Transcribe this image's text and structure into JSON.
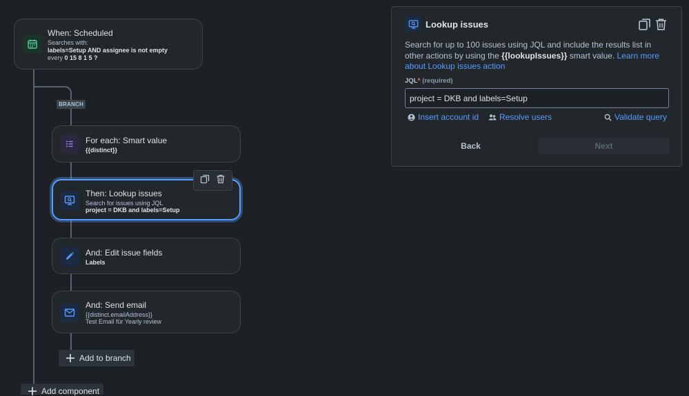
{
  "trigger": {
    "title": "When: Scheduled",
    "line1": "Searches with:",
    "line2": "labels=Setup AND assignee is not empty",
    "line3_prefix": "every ",
    "line3_value": "0 15 8 1 5 ?"
  },
  "branch_tag": "BRANCH",
  "foreach": {
    "title": "For each: Smart value",
    "sub": "{{distinct}}"
  },
  "lookup": {
    "title": "Then: Lookup issues",
    "sub1": "Search for issues using JQL",
    "sub2": "project = DKB and labels=Setup"
  },
  "edit": {
    "title": "And: Edit issue fields",
    "sub": "Labels"
  },
  "email": {
    "title": "And: Send email",
    "sub1": "{{distinct.emailAddress}}",
    "sub2": "Test Email für Yearly review"
  },
  "add_to_branch": "Add to branch",
  "add_component": "Add component",
  "panel": {
    "title": "Lookup issues",
    "desc_part1": "Search for up to 100 issues using JQL and include the results list in other actions by using the ",
    "desc_bold": "{{lookupIssues}}",
    "desc_part2": " smart value. ",
    "desc_link": "Learn more about Lookup issues action",
    "jql_label": "JQL",
    "jql_required_star": "*",
    "jql_required": "(required)",
    "jql_value": "project = DKB and labels=Setup",
    "insert_account": "Insert account id",
    "resolve_users": "Resolve users",
    "validate_query": "Validate query",
    "back": "Back",
    "next": "Next"
  },
  "colors": {
    "accent": "#579dff",
    "bg": "#1d2125",
    "card": "#22272b",
    "green_icon": "#4bce97",
    "purple_icon": "#9f8fef"
  }
}
